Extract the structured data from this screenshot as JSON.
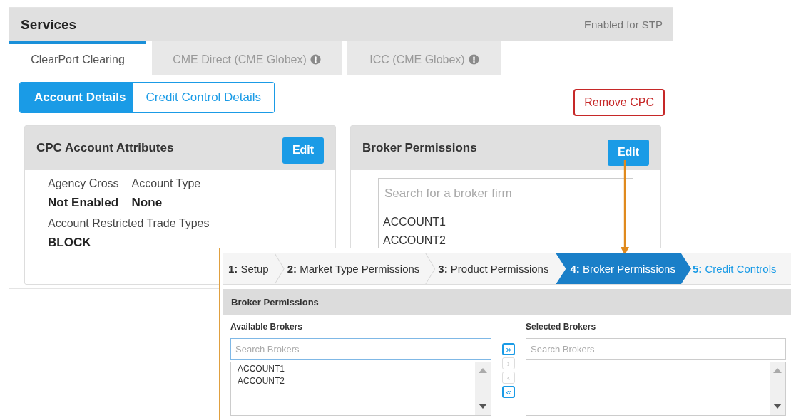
{
  "services": {
    "title": "Services",
    "status": "Enabled for STP",
    "tabs": [
      {
        "label": "ClearPort Clearing",
        "selected": true,
        "warning": false
      },
      {
        "label": "CME Direct (CME Globex)",
        "selected": false,
        "warning": true
      },
      {
        "label": "ICC (CME Globex)",
        "selected": false,
        "warning": true
      }
    ],
    "views": [
      {
        "label": "Account Details",
        "selected": true
      },
      {
        "label": "Credit Control Details",
        "selected": false
      }
    ],
    "remove_button": "Remove CPC",
    "attributes_card": {
      "title": "CPC Account Attributes",
      "edit_button": "Edit",
      "rows": [
        [
          {
            "label": "Agency Cross",
            "value": "Not Enabled"
          },
          {
            "label": "Account Type",
            "value": "None"
          }
        ],
        [
          {
            "label": "Account Restricted Trade Types",
            "value": "BLOCK"
          }
        ]
      ]
    },
    "broker_card": {
      "title": "Broker Permissions",
      "edit_button": "Edit",
      "search": {
        "placeholder": "Search for a broker firm"
      },
      "brokers": [
        "ACCOUNT1",
        "ACCOUNT2"
      ]
    }
  },
  "wizard": {
    "steps": [
      {
        "label": "**1:** Setup",
        "selected": false,
        "kind": "completed"
      },
      {
        "label": "**2:** Market Type Permissions",
        "selected": false,
        "kind": "completed"
      },
      {
        "label": "**3:** Product Permissions",
        "selected": false,
        "kind": "completed"
      },
      {
        "label": "**4:** Broker Permissions",
        "selected": true,
        "kind": "current"
      },
      {
        "label": "**5:** Credit Controls",
        "selected": false,
        "kind": "upcoming"
      }
    ],
    "section_title": "Broker Permissions",
    "available": {
      "label": "Available Brokers",
      "search": {
        "placeholder": "Search Brokers",
        "focused": true
      },
      "items": [
        "ACCOUNT1",
        "ACCOUNT2"
      ]
    },
    "transfer_buttons": [
      {
        "label": "»",
        "disabled": false
      },
      {
        "label": "›",
        "disabled": true
      },
      {
        "label": "‹",
        "disabled": true
      },
      {
        "label": "«",
        "disabled": false
      }
    ],
    "chosen": {
      "label": "Selected Brokers",
      "search": {
        "placeholder": "Search Brokers",
        "focused": false
      }
    }
  }
}
